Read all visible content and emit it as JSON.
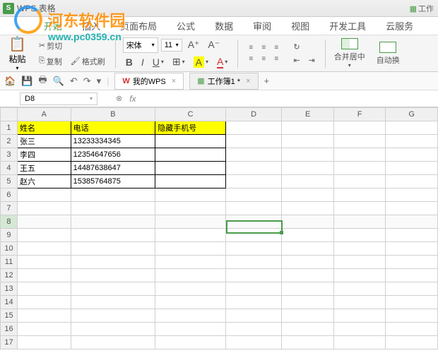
{
  "app": {
    "title": "WPS 表格",
    "work": "工作"
  },
  "watermark": {
    "text": "河东软件园",
    "url": "www.pc0359.cn"
  },
  "menu": {
    "items": [
      "开始",
      "插入",
      "页面布局",
      "公式",
      "数据",
      "审阅",
      "视图",
      "开发工具",
      "云服务"
    ]
  },
  "ribbon": {
    "cut": "剪切",
    "copy": "复制",
    "paste": "粘贴",
    "format_painter": "格式刷",
    "font": "宋体",
    "size": "11",
    "merge": "合并居中",
    "wrap": "自动换"
  },
  "tabs": {
    "wps": "我的WPS",
    "book": "工作簿1 *"
  },
  "namebox": "D8",
  "fx": "fx",
  "cols": [
    "A",
    "B",
    "C",
    "D",
    "E",
    "F",
    "G"
  ],
  "headers": {
    "a": "姓名",
    "b": "电话",
    "c": "隐藏手机号"
  },
  "rows": [
    {
      "a": "张三",
      "b": "13233334345"
    },
    {
      "a": "李四",
      "b": "12354647656"
    },
    {
      "a": "王五",
      "b": "14487638647"
    },
    {
      "a": "赵六",
      "b": "15385764875"
    }
  ],
  "active": {
    "row": 8,
    "col": "D"
  }
}
